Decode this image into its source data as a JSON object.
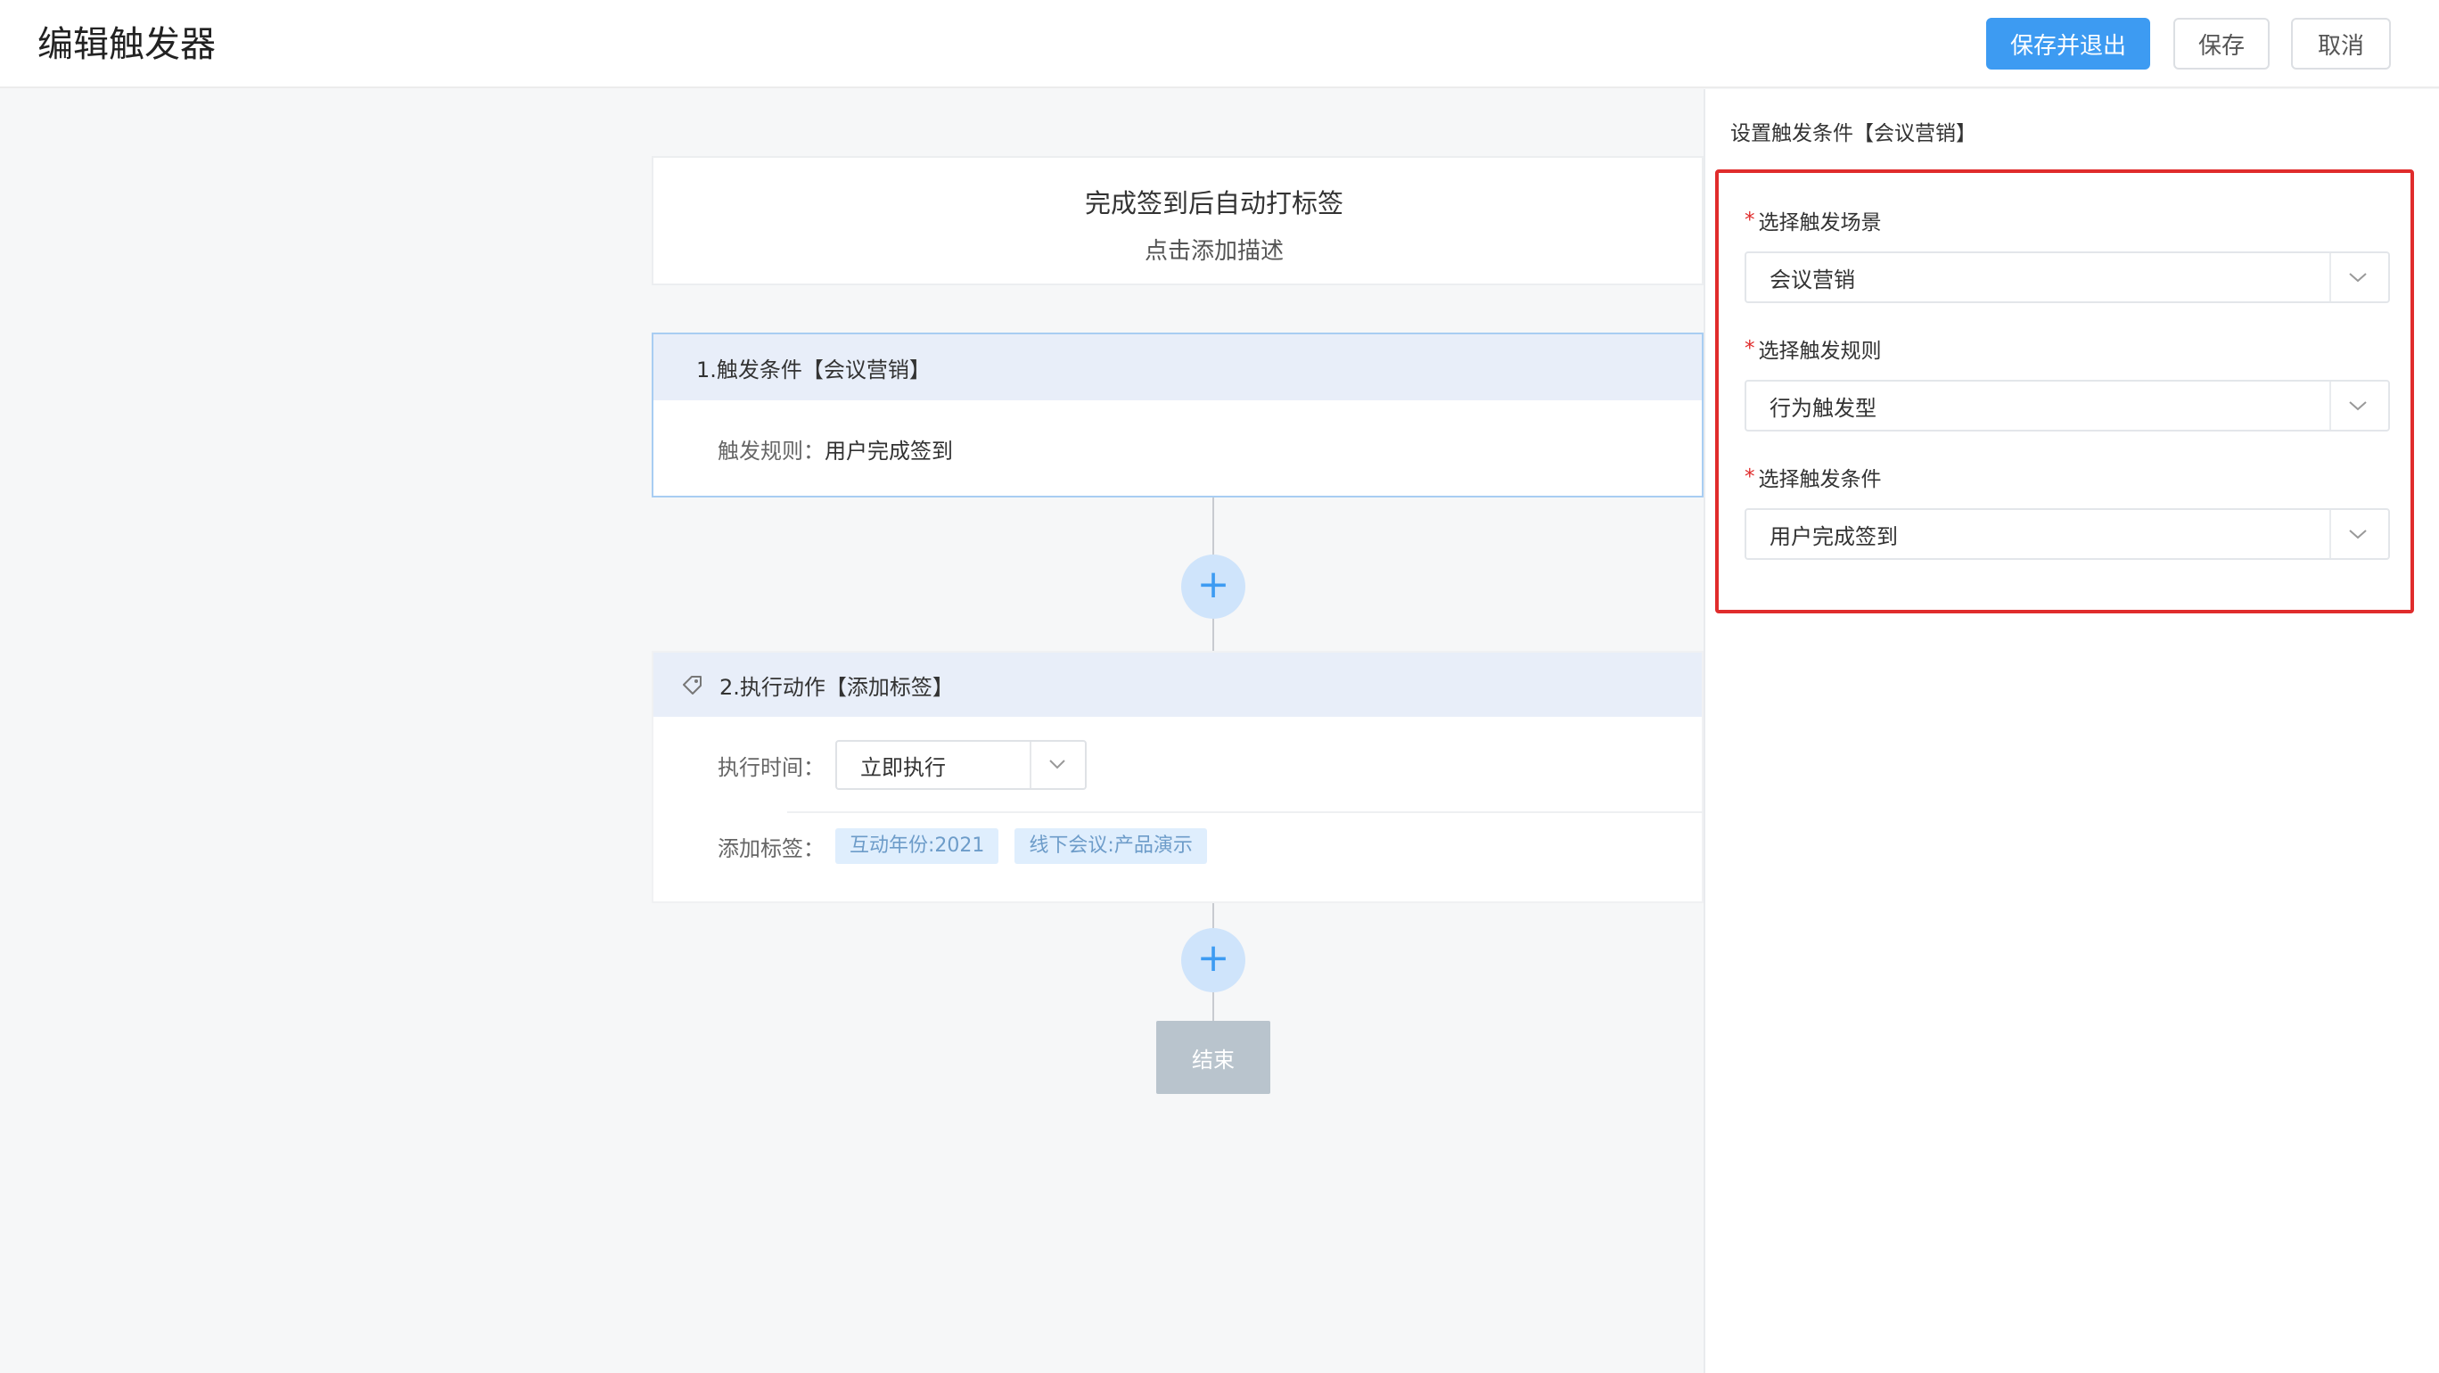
{
  "header": {
    "title": "编辑触发器",
    "save_exit_label": "保存并退出",
    "save_label": "保存",
    "cancel_label": "取消"
  },
  "flow": {
    "title": "完成签到后自动打标签",
    "description_hint": "点击添加描述",
    "node1": {
      "heading": "1.触发条件【会议营销】",
      "rule_label": "触发规则：",
      "rule_value": "用户完成签到"
    },
    "node2": {
      "heading": "2.执行动作【添加标签】",
      "heading_icon": "tag-icon",
      "exec_time_label": "执行时间：",
      "exec_time_value": "立即执行",
      "add_tags_label": "添加标签：",
      "tags": [
        "互动年份:2021",
        "线下会议:产品演示"
      ]
    },
    "add_step_symbol": "+",
    "end_label": "结束"
  },
  "panel": {
    "title": "设置触发条件【会议营销】",
    "required_mark": "*",
    "fields": [
      {
        "label": "选择触发场景",
        "value": "会议营销"
      },
      {
        "label": "选择触发规则",
        "value": "行为触发型"
      },
      {
        "label": "选择触发条件",
        "value": "用户完成签到"
      }
    ]
  },
  "colors": {
    "primary": "#3d9bf2",
    "highlight_border": "#e02c2c",
    "node_header_bg": "#e8eef9",
    "tag_bg": "#dfeefd",
    "end_button_bg": "#b9c4cd"
  }
}
